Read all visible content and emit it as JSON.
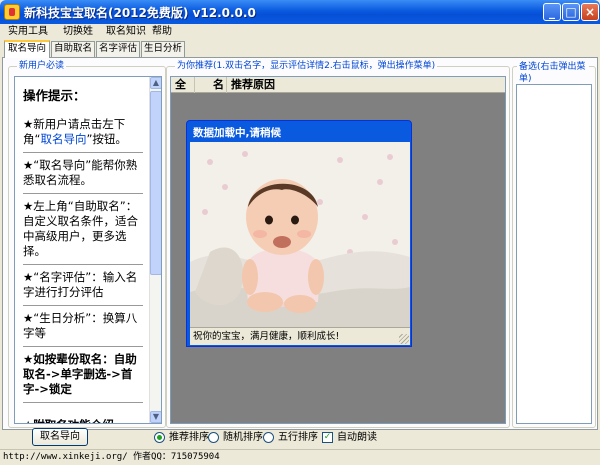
{
  "window": {
    "title": "新科技宝宝取名(2012免费版) v12.0.0.0",
    "min_glyph": "_",
    "max_glyph": "□",
    "close_glyph": "×"
  },
  "menu": [
    "实用工具",
    "切换姓",
    "取名知识",
    "帮助"
  ],
  "tabs": [
    "取名导向",
    "自助取名",
    "名字评估",
    "生日分析"
  ],
  "left_panel": {
    "group_label": "新用户必读",
    "heading": "操作提示：",
    "tip1_pre": "★新用户请点击左下角“",
    "tip1_link": "取名导向",
    "tip1_post": "”按钮。",
    "tip2": "★“取名导向”能帮你熟悉取名流程。",
    "tip3": "★左上角“自助取名”：自定义取名条件，适合中高级用户，更多选择。",
    "tip4": "★“名字评估”：输入名字进行打分评估",
    "tip5": "★“生日分析”：换算八字等",
    "tip6": "★如按辈份取名：自助取名->单字删选->首字->锁定",
    "tip7": "★附取名功能介绍"
  },
  "center_panel": {
    "group_label": "为你推荐(1.双击名字，显示评估详情2.右击鼠标，弹出操作菜单)",
    "col_all": "全",
    "col_name": "名",
    "col_reason": "推荐原因"
  },
  "popup": {
    "title": "数据加载中,请稍候",
    "status": "祝你的宝宝，满月健康，顺利成长!"
  },
  "right_panel": {
    "group_label": "备选(右击弹出菜单)"
  },
  "bottom": {
    "guide_button": "取名导向",
    "options": [
      {
        "label": "推荐排序",
        "type": "radio",
        "checked": true
      },
      {
        "label": "随机排序",
        "type": "radio",
        "checked": false
      },
      {
        "label": "五行排序",
        "type": "radio",
        "checked": false
      },
      {
        "label": "自动朗读",
        "type": "checkbox",
        "checked": true
      }
    ]
  },
  "status_bar": {
    "text": "http://www.xinkeji.org/ 作者QQ：715075904"
  },
  "colors": {
    "title_blue": "#0a5ae0",
    "link_blue": "#0046d5",
    "list_gray": "#808080"
  }
}
